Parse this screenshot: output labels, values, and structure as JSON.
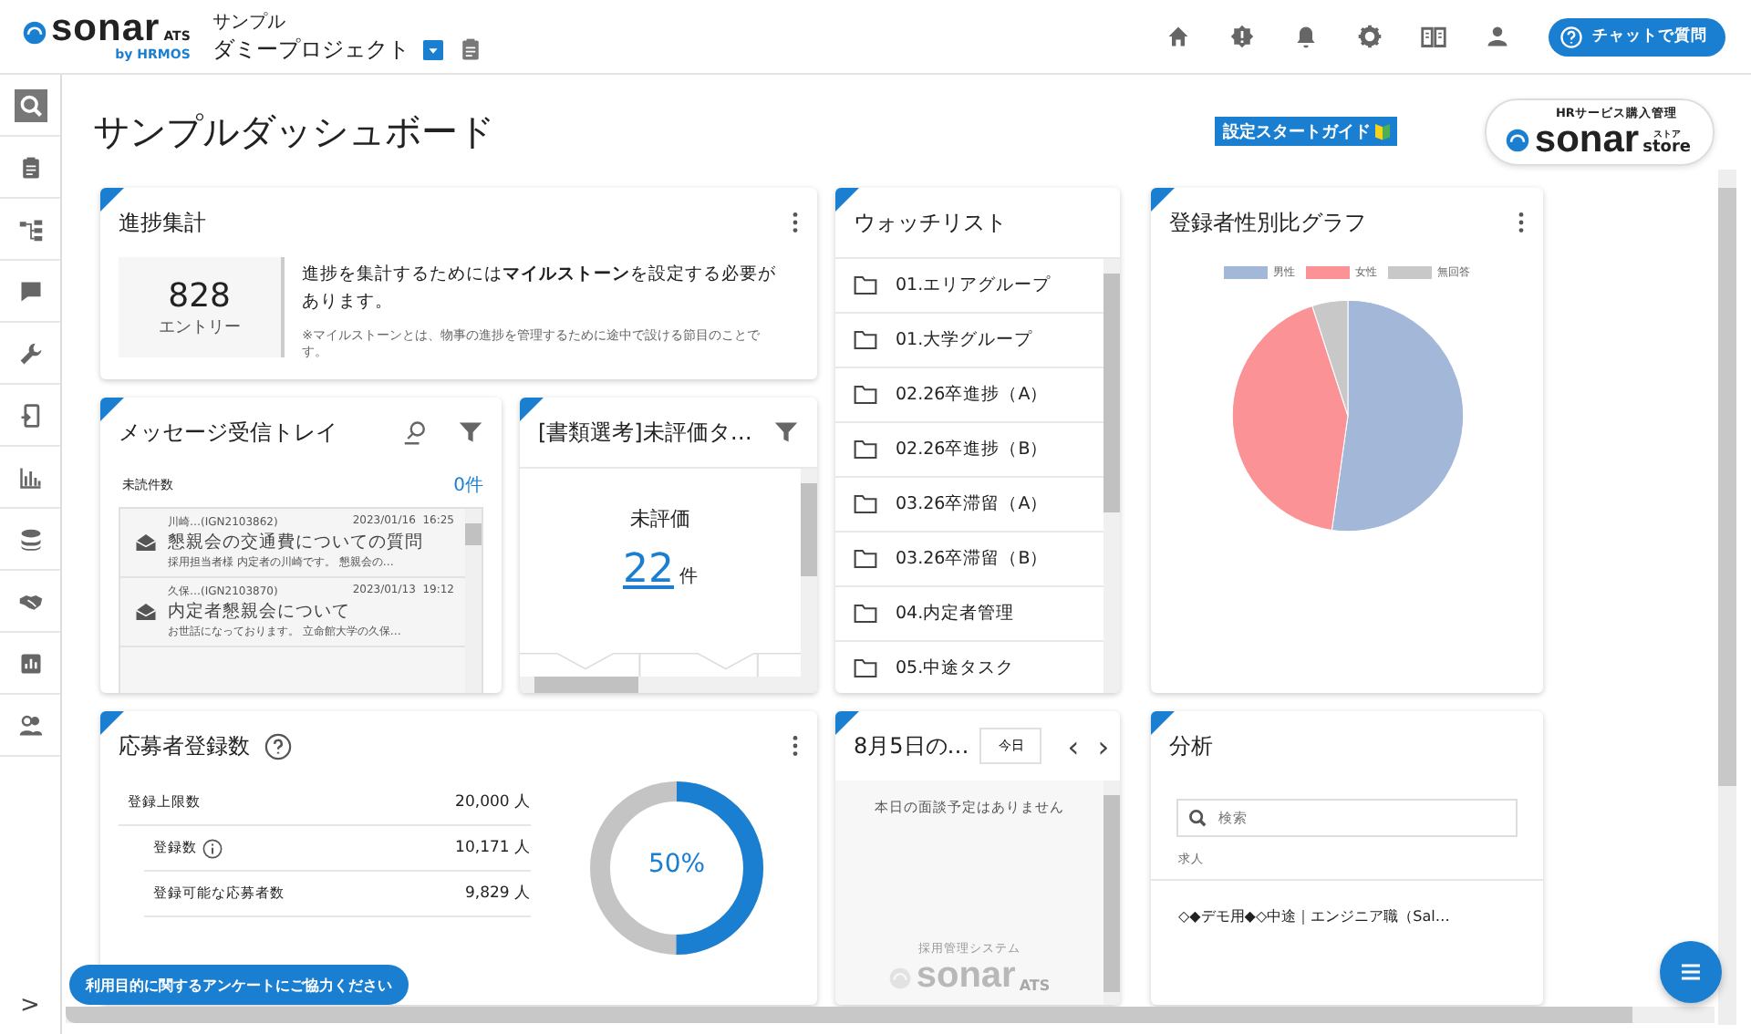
{
  "header": {
    "logo": "sonar",
    "logo_suffix": "ATS",
    "logo_by": "by HRMOS",
    "project_label": "サンプル",
    "project_name": "ダミープロジェクト",
    "chat_button": "チャットで質問"
  },
  "sidebar": {
    "items": [
      {
        "kind": "search",
        "selected": true
      },
      {
        "kind": "clipboard",
        "selected": false
      },
      {
        "kind": "flow",
        "selected": false
      },
      {
        "kind": "chat",
        "selected": false
      },
      {
        "kind": "wrench",
        "selected": false
      },
      {
        "kind": "phone",
        "selected": false
      },
      {
        "kind": "bars",
        "selected": false
      },
      {
        "kind": "database",
        "selected": false
      },
      {
        "kind": "handshake",
        "selected": false
      },
      {
        "kind": "report",
        "selected": false
      },
      {
        "kind": "people",
        "selected": false
      }
    ],
    "expand": ">"
  },
  "page": {
    "title": "サンプルダッシュボード",
    "guide_button": "設定スタートガイド",
    "store": {
      "caption": "HRサービス購入管理",
      "name": "sonar",
      "suffix_kana": "ストア",
      "suffix": "store"
    }
  },
  "progress": {
    "title": "進捗集計",
    "count": "828",
    "count_label": "エントリー",
    "message": "進捗を集計するためには**マイルストーン**を設定する必要があります。",
    "note": "※マイルストーンとは、物事の進捗を管理するために途中で設ける節目のことです。"
  },
  "messages": {
    "title": "メッセージ受信トレイ",
    "unread_label": "未読件数",
    "unread_count": "0件",
    "items": [
      {
        "sender": "川崎…(IGN2103862)",
        "date": "2023/01/16",
        "time": "16:25",
        "subject": "懇親会の交通費についての質問",
        "preview": "採用担当者様 内定者の川崎です。 懇親会の…"
      },
      {
        "sender": "久保…(IGN2103870)",
        "date": "2023/01/13",
        "time": "19:12",
        "subject": "内定者懇親会について",
        "preview": "お世話になっております。 立命館大学の久保…"
      }
    ]
  },
  "evaluation": {
    "title": "[書類選考]未評価タ…",
    "label": "未評価",
    "count": "22",
    "unit": "件"
  },
  "watchlist": {
    "title": "ウォッチリスト",
    "items": [
      "01.エリアグループ",
      "01.大学グループ",
      "02.26卒進捗（A）",
      "02.26卒進捗（B）",
      "03.26卒滞留（A）",
      "03.26卒滞留（B）",
      "04.内定者管理",
      "05.中途タスク"
    ]
  },
  "gender": {
    "title": "登録者性別比グラフ",
    "legend": [
      {
        "label": "男性",
        "color": "#a3b8d9"
      },
      {
        "label": "女性",
        "color": "#fb9396"
      },
      {
        "label": "無回答",
        "color": "#c8c8c8"
      }
    ]
  },
  "applicants": {
    "title": "応募者登録数",
    "rows": [
      {
        "label": "登録上限数",
        "value": "20,000 人",
        "info": false,
        "children": [
          {
            "label": "登録数",
            "value": "10,171 人",
            "info": true
          },
          {
            "label": "登録可能な応募者数",
            "value": "9,829 人",
            "info": false
          }
        ]
      }
    ],
    "gauge": {
      "level": 0.5,
      "reading": "50%"
    }
  },
  "calendar": {
    "title": "8月5日の…",
    "today_button": "今日",
    "prev": "‹",
    "next": "›",
    "empty": "本日の面談予定はありません",
    "logo_caption": "採用管理システム",
    "logo_name": "sonar",
    "logo_suffix": "ATS"
  },
  "analysis": {
    "title": "分析",
    "search": {
      "placeholder": "検索"
    },
    "section": "求人",
    "items": [
      "◇◆デモ用◆◇中途｜エンジニア職（Sal…"
    ]
  },
  "survey_button": "利用目的に関するアンケートにご協力ください"
}
